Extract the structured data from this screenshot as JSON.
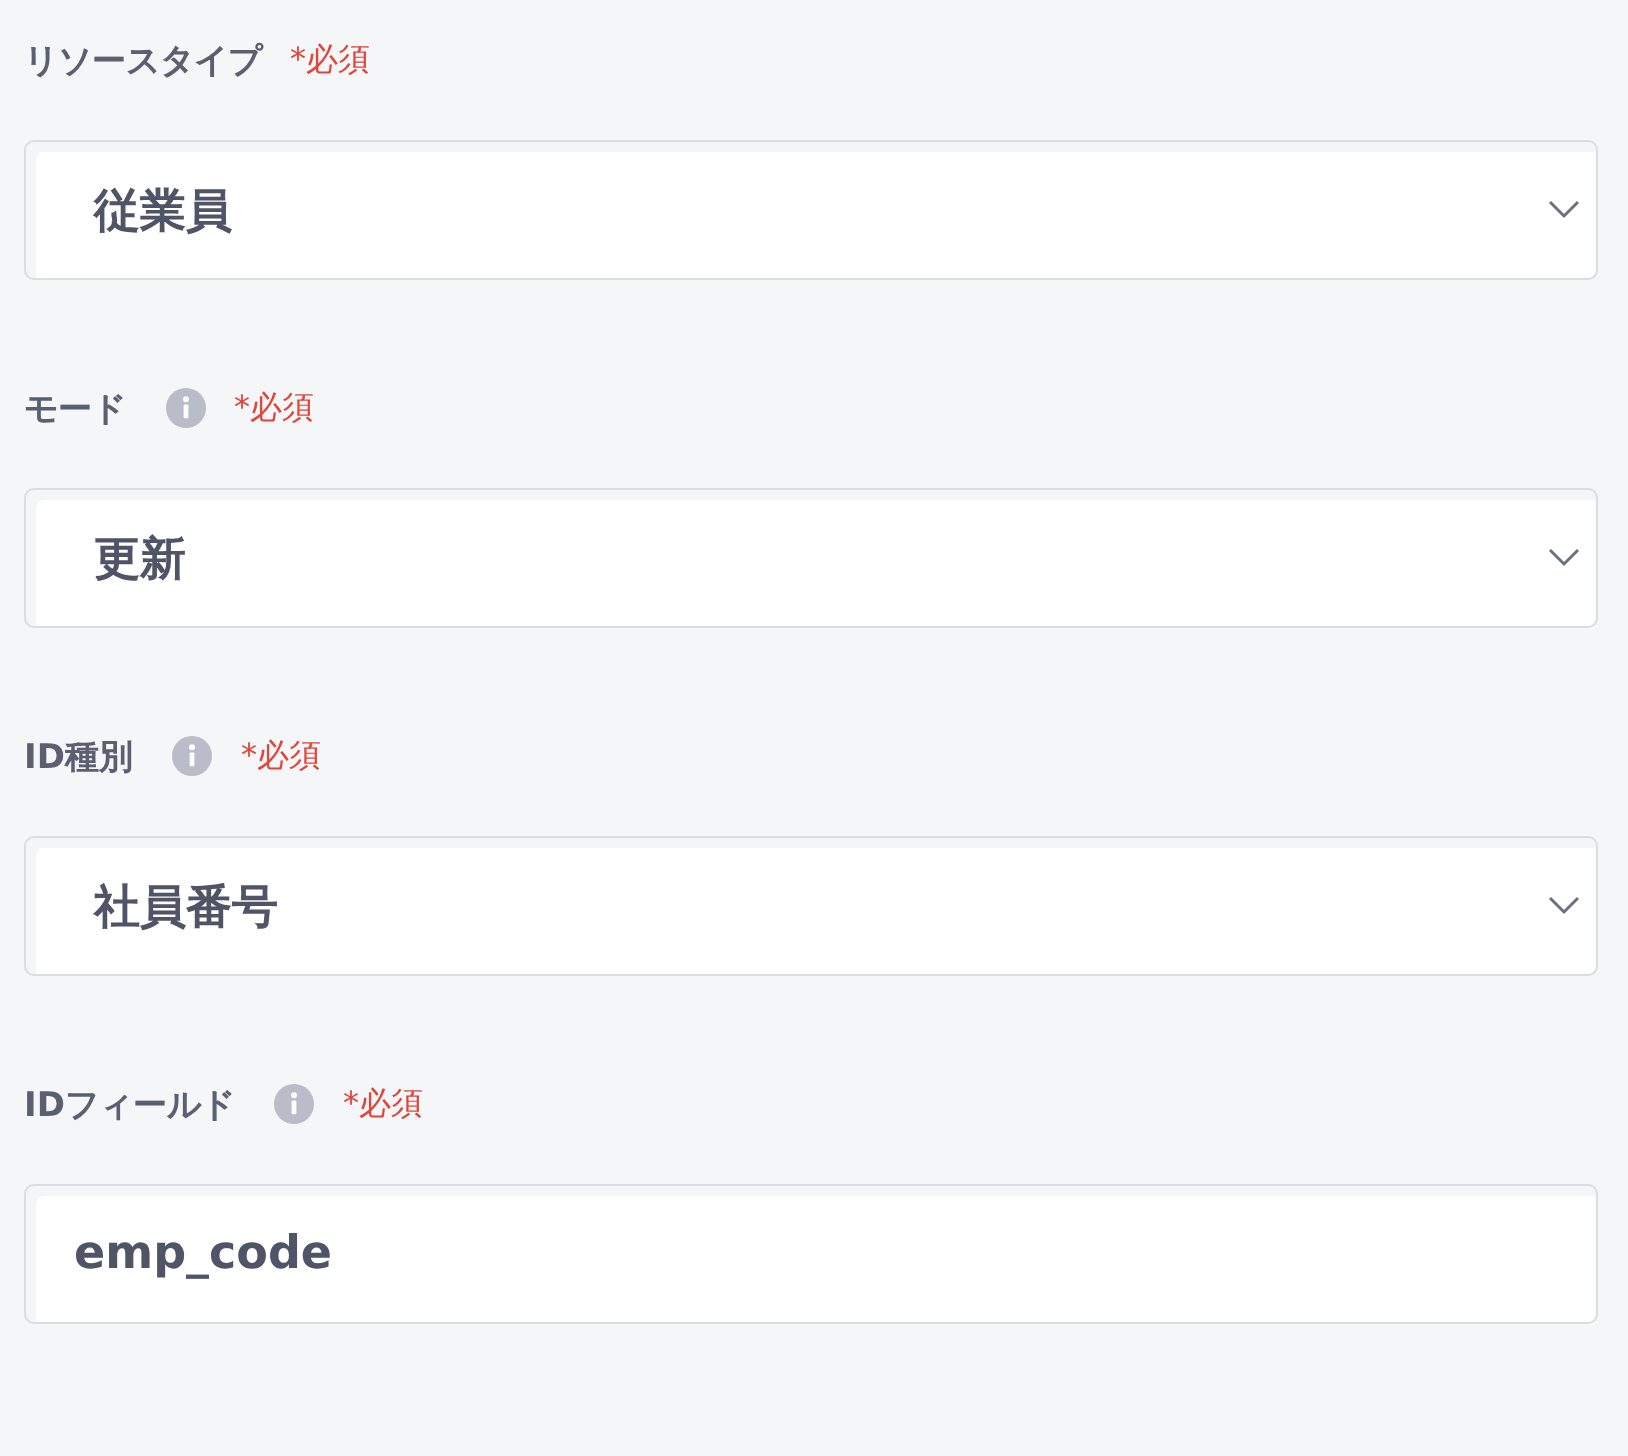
{
  "fields": [
    {
      "label": "リソースタイプ",
      "info": false,
      "required": "*必須",
      "kind": "select",
      "value": "従業員"
    },
    {
      "label": "モード",
      "info": true,
      "required": "*必須",
      "kind": "select",
      "value": "更新"
    },
    {
      "label": "ID種別",
      "info": true,
      "required": "*必須",
      "kind": "select",
      "value": "社員番号"
    },
    {
      "label": "IDフィールド",
      "info": true,
      "required": "*必須",
      "kind": "text",
      "value": "emp_code"
    }
  ]
}
